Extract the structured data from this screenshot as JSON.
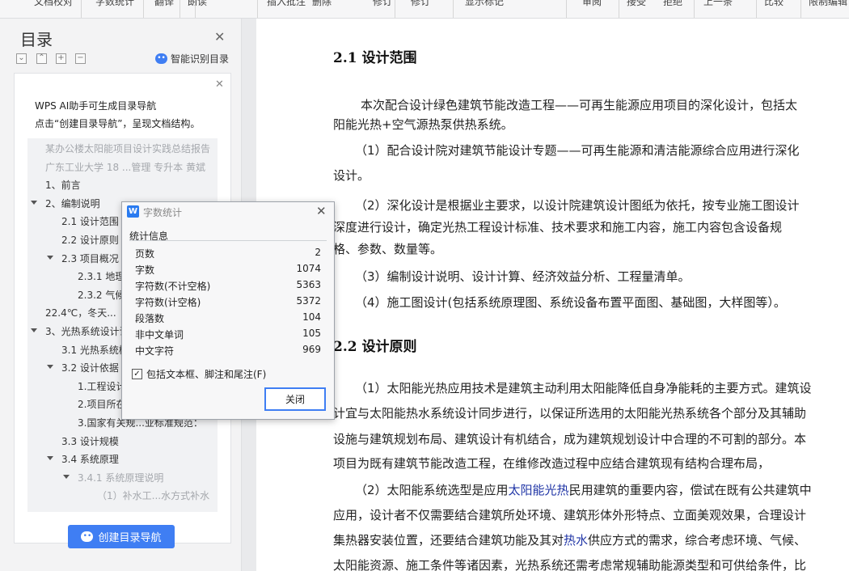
{
  "toolbar": {
    "items": [
      "文档校对",
      "字数统计",
      "翻译",
      "朗读",
      "修订",
      "插入批注",
      "删除",
      "修订",
      "显示标记",
      "审阅",
      "接受",
      "拒绝",
      "上一条",
      "比较",
      "限制编辑"
    ]
  },
  "nav": {
    "title": "目录",
    "ai_recognize": "智能识别目录",
    "hint_line1": "WPS AI助手可生成目录导航",
    "hint_line2": "点击“创建目录导航”，呈现文档结构。",
    "outline": [
      {
        "text": "某办公楼太阳能项目设计实践总结报告",
        "gray": true
      },
      {
        "text": "广东工业大学 18 ...管理 专升本 黄斌",
        "gray": true
      },
      {
        "text": "1、前言"
      },
      {
        "text": "2、编制说明"
      },
      {
        "text": "2.1 设计范围"
      },
      {
        "text": "2.2 设计原则"
      },
      {
        "text": "2.3 项目概况"
      },
      {
        "text": "2.3.1 地理"
      },
      {
        "text": "2.3.2 气候"
      },
      {
        "text": "22.4℃，冬天..."
      },
      {
        "text": "3、光热系统设计说"
      },
      {
        "text": "3.1 光热系统概"
      },
      {
        "text": "3.2 设计依据"
      },
      {
        "text": "1.工程设计"
      },
      {
        "text": "2.项目所在"
      },
      {
        "text": "3.国家有关规...业标准规范："
      },
      {
        "text": "3.3 设计规模"
      },
      {
        "text": "3.4 系统原理"
      },
      {
        "text": "3.4.1 系统原理说明",
        "gray": true
      },
      {
        "text": "（1）补水工...水方式补水",
        "gray": true
      }
    ],
    "create_button": "创建目录导航"
  },
  "doc": {
    "heading1": "2.1 设计范围",
    "p1": [
      "本次配合设计绿色建筑节能改造工程——可再生能源应用项目的深化设计，包括太",
      "阳能光热+空气源热泵供热系统。"
    ],
    "p2": [
      "（1）配合设计院对建筑节能设计专题——可再生能源和清洁能源综合应用进行深化",
      "设计。"
    ],
    "p3": [
      "（2）深化设计是根据业主要求，以设计院建筑设计图纸为依托，按专业施工图设计",
      "深度进行设计，确定光热工程设计标准、技术要求和施工内容，施工内容包含设备规",
      "格、参数、数量等。"
    ],
    "p4": "（3）编制设计说明、设计计算、经济效益分析、工程量清单。",
    "p5": "（4）施工图设计(包括系统原理图、系统设备布置平面图、基础图，大样图等）。",
    "heading2": "2.2 设计原则",
    "p6": [
      "（1）太阳能光热应用技术是建筑主动利用太阳能降低自身净能耗的主要方式。建筑设",
      "计宜与太阳能热水系统设计同步进行，以保证所选用的太阳能光热系统各个部分及其辅助",
      "设施与建筑规划布局、建筑设计有机结合，成为建筑规划设计中合理的不可割的部分。本",
      "项目为既有建筑节能改造工程，在维修改造过程中应结合建筑现有结构合理布局，"
    ],
    "p7_a": "（2）太阳能系统选型是应用",
    "p7_link": "太阳能光热",
    "p7_b": "民用建筑的重要内容，偿试在既有公共建筑中",
    "p7_l2": "应用，设计者不仅需要结合建筑所处环境、建筑形体外形特点、立面美观效果，合理设计",
    "p7_l3a": "集热器安装位置，还要结合建筑功能及其对",
    "p7_l3link": "热水",
    "p7_l3b": "供应方式的需求，综合考虑环境、气候、",
    "p7_l4": "太阳能资源、施工条件等诸因素，光热系统还需考虑常规辅助能源类型和可供给条件，比"
  },
  "dialog": {
    "logo": "W",
    "title": "字数统计",
    "section": "统计信息",
    "stats": [
      {
        "label": "页数",
        "value": "2"
      },
      {
        "label": "字数",
        "value": "1074"
      },
      {
        "label": "字符数(不计空格)",
        "value": "5363"
      },
      {
        "label": "字符数(计空格)",
        "value": "5372"
      },
      {
        "label": "段落数",
        "value": "104"
      },
      {
        "label": "非中文单词",
        "value": "105"
      },
      {
        "label": "中文字符",
        "value": "969"
      }
    ],
    "checkbox_label": "包括文本框、脚注和尾注(F)",
    "checkbox_checked": true,
    "close_label": "关闭"
  }
}
